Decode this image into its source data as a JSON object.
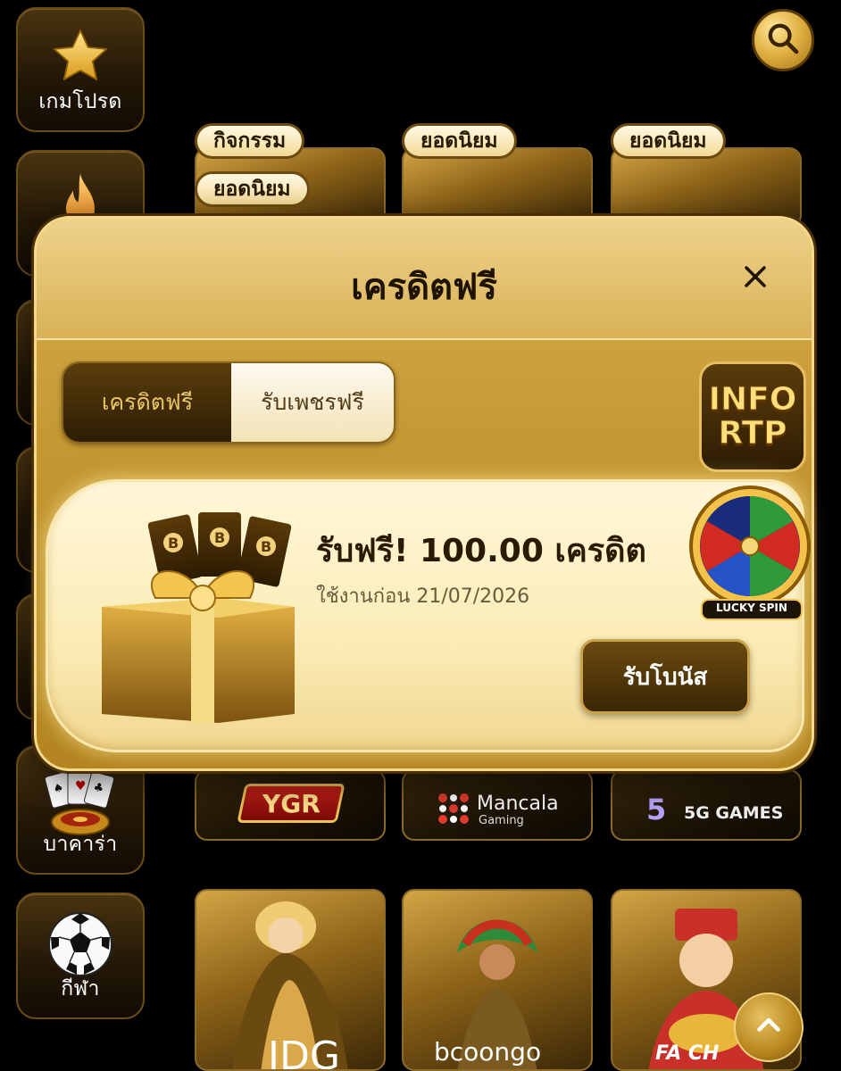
{
  "sidebar": {
    "items": [
      {
        "label": "เกมโปรด",
        "icon": "star-icon"
      },
      {
        "label": "",
        "icon": "fire-icon"
      },
      {
        "label": "",
        "icon": "slot-icon"
      },
      {
        "label": "",
        "icon": "fish-icon"
      },
      {
        "label": "",
        "icon": "lottery-icon"
      },
      {
        "label": "บาคาร่า",
        "icon": "cards-icon"
      },
      {
        "label": "กีฬา",
        "icon": "soccer-ball-icon"
      }
    ]
  },
  "search": {
    "icon": "search-icon"
  },
  "top_cards": [
    {
      "tags": [
        "กิจกรรม",
        "ยอดนิยม"
      ]
    },
    {
      "tags": [
        "ยอดนิยม"
      ]
    },
    {
      "tags": [
        "ยอดนิยม"
      ]
    }
  ],
  "providers": [
    {
      "name": "YGR"
    },
    {
      "name": "Mancala",
      "sub": "Gaming"
    },
    {
      "name": "5G GAMES"
    }
  ],
  "bottom_cards": [
    {
      "logo": "IDG"
    },
    {
      "logo": "bcoongo"
    },
    {
      "logo": "FA CH"
    }
  ],
  "modal": {
    "title": "เครดิตฟรี",
    "tabs": [
      {
        "label": "เครดิตฟรี",
        "active": true
      },
      {
        "label": "รับเพชรฟรี",
        "active": false
      }
    ],
    "rtp_button": {
      "line1": "INFO",
      "line2": "RTP"
    },
    "bonus": {
      "title": "รับฟรี! 100.00 เครดิต",
      "expiry": "ใช้งานก่อน 21/07/2026",
      "claim_label": "รับโบนัส"
    },
    "lucky_spin_label": "LUCKY SPIN"
  },
  "colors": {
    "gold": "#d9ae4e",
    "dark": "#000000",
    "accent": "#e9c766"
  }
}
